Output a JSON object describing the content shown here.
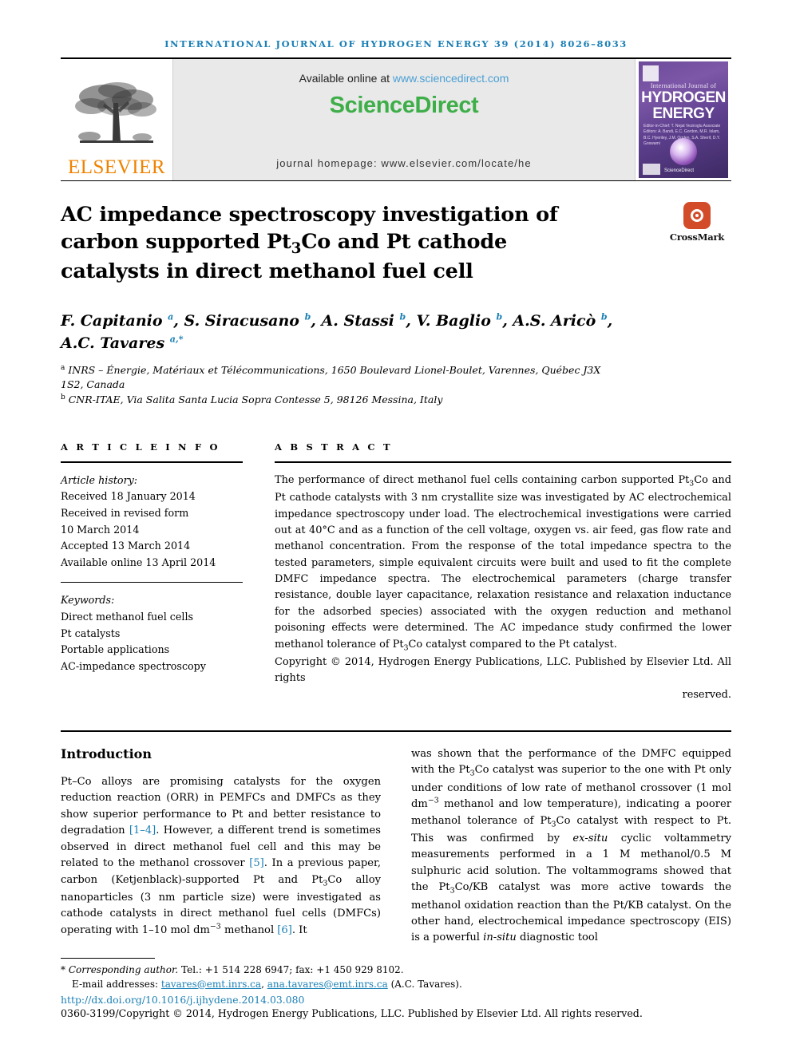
{
  "running_head": "INTERNATIONAL JOURNAL OF HYDROGEN ENERGY 39 (2014) 8026–8033",
  "masthead": {
    "publisher_name": "ELSEVIER",
    "publisher_logo_name": "elsevier-tree-logo",
    "available_text": "Available online at ",
    "sciencedirect_url": "www.sciencedirect.com",
    "sciencedirect_logo": "ScienceDirect",
    "journal_homepage": "journal homepage: www.elsevier.com/locate/he",
    "cover": {
      "subtitle": "International Journal of",
      "title_line1": "HYDROGEN",
      "title_line2": "ENERGY",
      "editors": "Editor-in-Chief:  T. Nejat Veziroglu    Associate Editors:  A. Bandi, E.C. Gordon, M.R. Islam,  B.C. Hyeriley, J.M. Ogden, S.A. Sherif, D.Y. Goswami",
      "sciencedirect_mark": "ScienceDirect"
    }
  },
  "title": "AC impedance spectroscopy investigation of carbon supported Pt₃Co and Pt cathode catalysts in direct methanol fuel cell",
  "crossmark": {
    "label": "CrossMark",
    "icon": "crossmark-icon",
    "color": "#d24c2a"
  },
  "authors_html": "F. Capitanio <sup>a</sup>, S. Siracusano <sup>b</sup>, A. Stassi <sup>b</sup>, V. Baglio <sup>b</sup>, A.S. Aricò <sup>b</sup>, A.C. Tavares <sup>a,*</sup>",
  "affiliations": [
    "<sup>a</sup> INRS – Énergie, Matériaux et Télécommunications, 1650 Boulevard Lionel-Boulet, Varennes, Québec J3X 1S2, Canada",
    "<sup>b</sup> CNR-ITAE, Via Salita Santa Lucia Sopra Contesse 5, 98126 Messina, Italy"
  ],
  "article_info": {
    "heading": "A R T I C L E   I N F O",
    "history_label": "Article history:",
    "history": [
      "Received 18 January 2014",
      "Received in revised form",
      "10 March 2014",
      "Accepted 13 March 2014",
      "Available online 13 April 2014"
    ],
    "keywords_label": "Keywords:",
    "keywords": [
      "Direct methanol fuel cells",
      "Pt catalysts",
      "Portable applications",
      "AC-impedance spectroscopy"
    ]
  },
  "abstract": {
    "heading": "A B S T R A C T",
    "text": "The performance of direct methanol fuel cells containing carbon supported Pt₃Co and Pt cathode catalysts with 3 nm crystallite size was investigated by AC electrochemical impedance spectroscopy under load. The electrochemical investigations were carried out at 40°C and as a function of the cell voltage, oxygen vs. air feed, gas flow rate and methanol concentration. From the response of the total impedance spectra to the tested parameters, simple equivalent circuits were built and used to fit the complete DMFC impedance spectra. The electrochemical parameters (charge transfer resistance, double layer capacitance, relaxation resistance and relaxation inductance for the adsorbed species) associated with the oxygen reduction and methanol poisoning effects were determined. The AC impedance study confirmed the lower methanol tolerance of Pt₃Co catalyst compared to the Pt catalyst.",
    "copyright": "Copyright © 2014, Hydrogen Energy Publications, LLC. Published by Elsevier Ltd. All rights",
    "copyright_last": "reserved."
  },
  "introduction": {
    "heading": "Introduction",
    "left_html": "Pt–Co alloys are promising catalysts for the oxygen reduction reaction (ORR) in PEMFCs and DMFCs as they show superior performance to Pt and better resistance to degradation <span class=\"ref\">[1–4]</span>. However, a different trend is sometimes observed in direct methanol fuel cell and this may be related to the methanol crossover <span class=\"ref\">[5]</span>. In a previous paper, carbon (Ketjenblack)-supported Pt and Pt<sub>3</sub>Co alloy nanoparticles (3 nm particle size) were investigated as cathode catalysts in direct methanol fuel cells (DMFCs) operating with 1–10 mol dm<sup class=\"num\">−3</sup> methanol <span class=\"ref\">[6]</span>. It",
    "right_html": "was shown that the performance of the DMFC equipped with the Pt<sub>3</sub>Co catalyst was superior to the one with Pt only under conditions of low rate of methanol crossover (1 mol dm<sup class=\"num\">−3</sup> methanol and low temperature), indicating a poorer methanol tolerance of Pt<sub>3</sub>Co catalyst with respect to Pt. This was confirmed by <i>ex-situ</i> cyclic voltammetry measurements performed in a 1 M methanol/0.5 M sulphuric acid solution. The voltammograms showed that the Pt<sub>3</sub>Co/KB catalyst was more active towards the methanol oxidation reaction than the Pt/KB catalyst. On the other hand, electrochemical impedance spectroscopy (EIS) is a powerful <i>in-situ</i> diagnostic tool"
  },
  "footnote": {
    "corresponding_html": "<span class=\"ital\">* Corresponding author.</span> Tel.: +1 514 228 6947; fax: +1 450 929 8102.",
    "emails_label": "E-mail addresses:",
    "email1": "tavares@emt.inrs.ca",
    "email2": "ana.tavares@emt.inrs.ca",
    "email_owner": "(A.C. Tavares).",
    "doi": "http://dx.doi.org/10.1016/j.ijhydene.2014.03.080",
    "issn_line": "0360-3199/Copyright © 2014, Hydrogen Energy Publications, LLC. Published by Elsevier Ltd. All rights reserved."
  }
}
